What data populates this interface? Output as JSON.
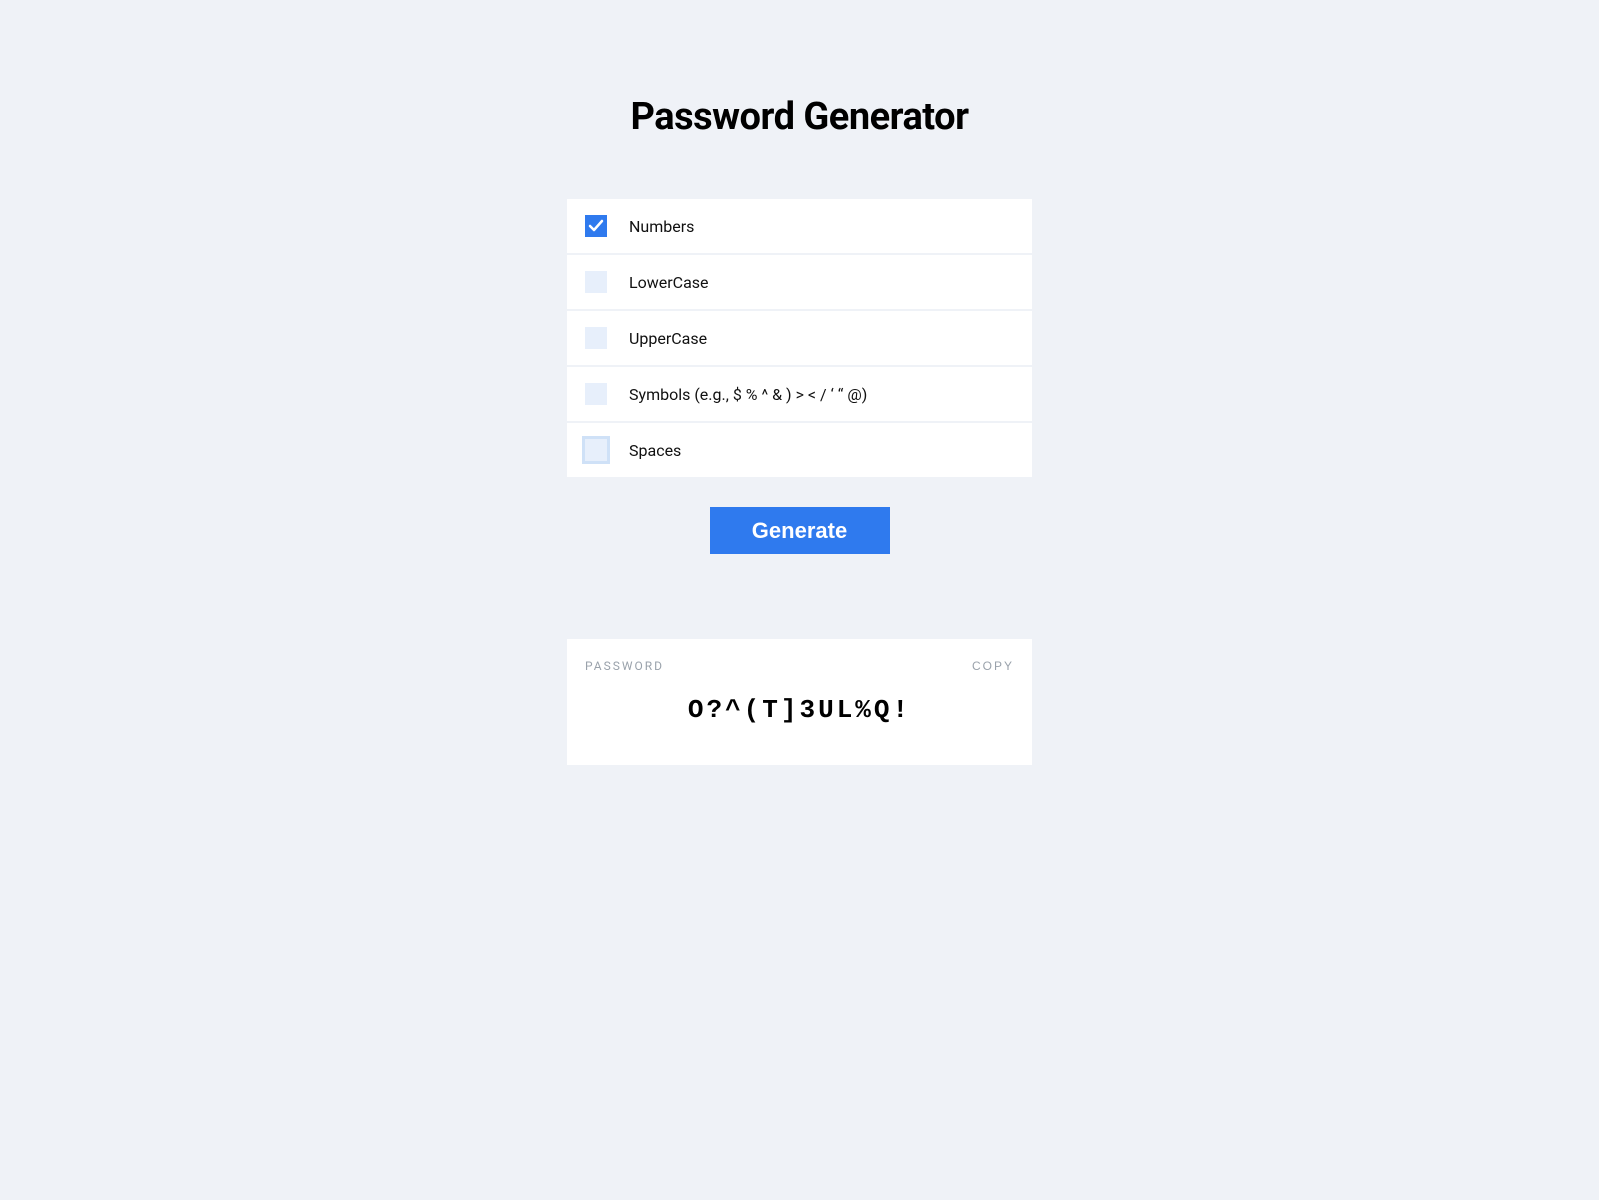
{
  "title": "Password Generator",
  "options": [
    {
      "label": "Numbers",
      "checked": true,
      "focused": false
    },
    {
      "label": "LowerCase",
      "checked": false,
      "focused": false
    },
    {
      "label": "UpperCase",
      "checked": false,
      "focused": false
    },
    {
      "label": "Symbols (e.g., $ % ^ & ) > < / ‘ “ @)",
      "checked": false,
      "focused": false
    },
    {
      "label": "Spaces",
      "checked": false,
      "focused": true
    }
  ],
  "generate_button": "Generate",
  "result": {
    "label": "PASSWORD",
    "copy_label": "COPY",
    "value": "O?^(T]3UL%Q!"
  }
}
